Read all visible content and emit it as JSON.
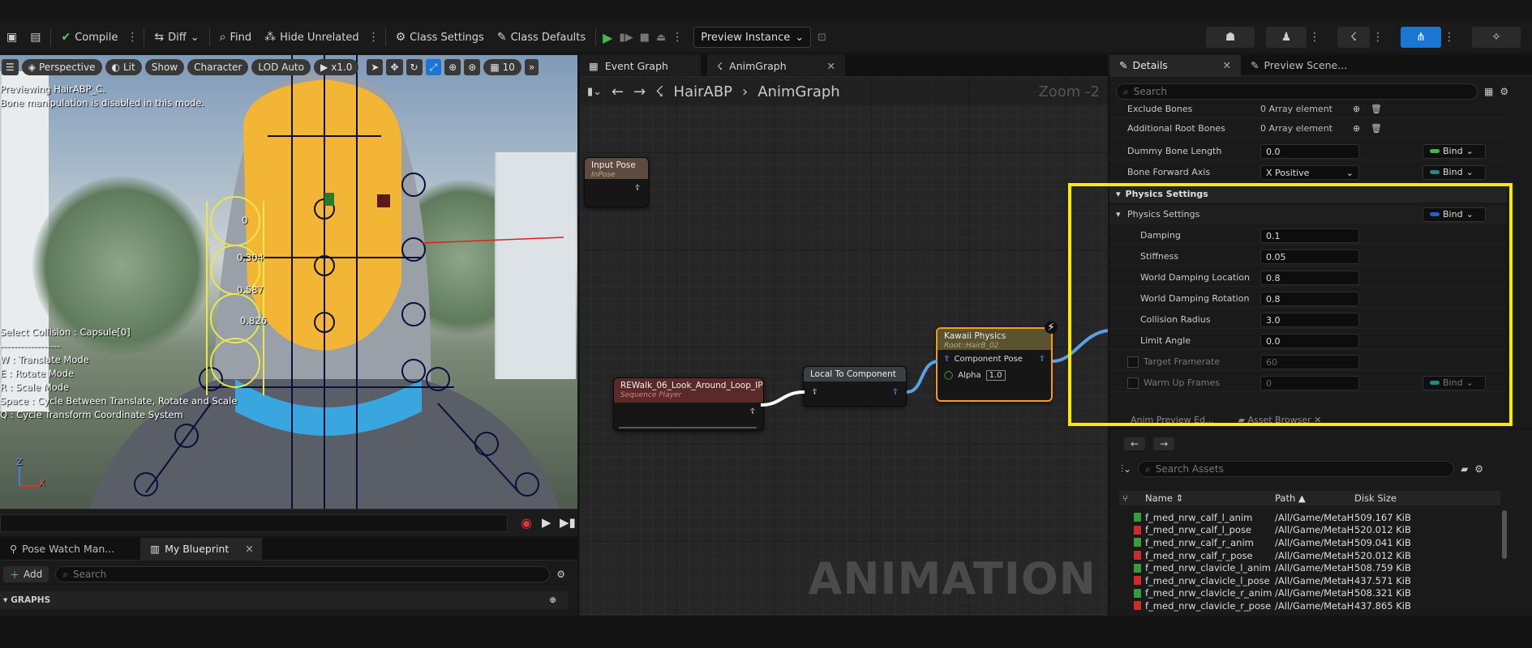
{
  "toolbar": {
    "compile": "Compile",
    "diff": "Diff",
    "find": "Find",
    "hide_unrelated": "Hide Unrelated",
    "class_settings": "Class Settings",
    "class_defaults": "Class Defaults",
    "preview_instance": "Preview Instance"
  },
  "viewport": {
    "menu_items": [
      "Perspective",
      "Lit",
      "Show",
      "Character",
      "LOD Auto",
      "x1.0",
      "10"
    ],
    "info_lines": [
      "Previewing HairABP_C.",
      "Bone manipulation is disabled in this mode."
    ],
    "help_lines": [
      "Select Collision : Capsule[0]",
      "------------------",
      "W : Translate Mode",
      "E : Rotate Mode",
      "R : Scale Mode",
      "Space : Cycle Between Translate, Rotate and Scale",
      "Q : Cycle Transform Coordinate System"
    ],
    "capsule_labels": [
      "0",
      "0.304",
      "0.587",
      "0.826"
    ],
    "axis_z": "Z",
    "axis_x": "X"
  },
  "bottom_left": {
    "tabs": [
      "Pose Watch Man...",
      "My Blueprint"
    ],
    "add_label": "Add",
    "search_placeholder": "Search",
    "section": "GRAPHS"
  },
  "graph": {
    "tabs": [
      "Event Graph",
      "AnimGraph"
    ],
    "breadcrumb_asset": "HairABP",
    "breadcrumb_graph": "AnimGraph",
    "zoom": "Zoom -2",
    "watermark": "ANIMATION",
    "nodes": {
      "input_pose": {
        "title": "Input Pose",
        "subtitle": "InPose"
      },
      "sequence": {
        "title": "REWalk_06_Look_Around_Loop_IP",
        "subtitle": "Sequence Player"
      },
      "local_to_component": {
        "title": "Local To Component"
      },
      "kawaii": {
        "title": "Kawaii Physics",
        "subtitle": "Root::HairB_02",
        "pin_component": "Component Pose",
        "pin_alpha": "Alpha",
        "alpha_value": "1.0"
      }
    }
  },
  "details": {
    "tabs": [
      "Details",
      "Preview Scene..."
    ],
    "search_placeholder": "Search",
    "rows_top": [
      {
        "label": "Exclude Bones",
        "value": "0 Array element"
      },
      {
        "label": "Additional Root Bones",
        "value": "0 Array element"
      },
      {
        "label": "Dummy Bone Length",
        "value": "0.0",
        "bind": "Bind"
      },
      {
        "label": "Bone Forward Axis",
        "value": "X Positive",
        "bind": "Bind"
      }
    ],
    "section": "Physics Settings",
    "sub_section": "Physics Settings",
    "sub_bind": "Bind",
    "physics": [
      {
        "label": "Damping",
        "value": "0.1"
      },
      {
        "label": "Stiffness",
        "value": "0.05"
      },
      {
        "label": "World Damping Location",
        "value": "0.8"
      },
      {
        "label": "World Damping Rotation",
        "value": "0.8"
      },
      {
        "label": "Collision Radius",
        "value": "3.0"
      },
      {
        "label": "Limit Angle",
        "value": "0.0"
      }
    ],
    "target_framerate": {
      "label": "Target Framerate",
      "value": "60"
    },
    "warm_up": {
      "label": "Warm Up Frames",
      "value": "0",
      "bind": "Bind"
    },
    "bottom_tabs": [
      "Anim Preview Ed...",
      "Asset Browser"
    ]
  },
  "assets": {
    "search_placeholder": "Search Assets",
    "columns": [
      "Name",
      "Path",
      "Disk Size"
    ],
    "rows": [
      {
        "name": "f_med_nrw_calf_l_anim",
        "path": "/All/Game/MetaH",
        "size": "509.167 KiB",
        "kind": "anim"
      },
      {
        "name": "f_med_nrw_calf_l_pose",
        "path": "/All/Game/MetaH",
        "size": "520.012 KiB",
        "kind": "pose"
      },
      {
        "name": "f_med_nrw_calf_r_anim",
        "path": "/All/Game/MetaH",
        "size": "509.041 KiB",
        "kind": "anim"
      },
      {
        "name": "f_med_nrw_calf_r_pose",
        "path": "/All/Game/MetaH",
        "size": "520.012 KiB",
        "kind": "pose"
      },
      {
        "name": "f_med_nrw_clavicle_l_anim",
        "path": "/All/Game/MetaH",
        "size": "508.759 KiB",
        "kind": "anim"
      },
      {
        "name": "f_med_nrw_clavicle_l_pose",
        "path": "/All/Game/MetaH",
        "size": "437.571 KiB",
        "kind": "pose"
      },
      {
        "name": "f_med_nrw_clavicle_r_anim",
        "path": "/All/Game/MetaH",
        "size": "508.321 KiB",
        "kind": "anim"
      },
      {
        "name": "f_med_nrw_clavicle_r_pose",
        "path": "/All/Game/MetaH",
        "size": "437.865 KiB",
        "kind": "pose"
      }
    ]
  },
  "colors": {
    "highlight": "#ffeb00",
    "accent": "#1976d2",
    "play": "#44b848",
    "anim_icon": "#3b9a3b",
    "pose_icon": "#d02a2a"
  }
}
